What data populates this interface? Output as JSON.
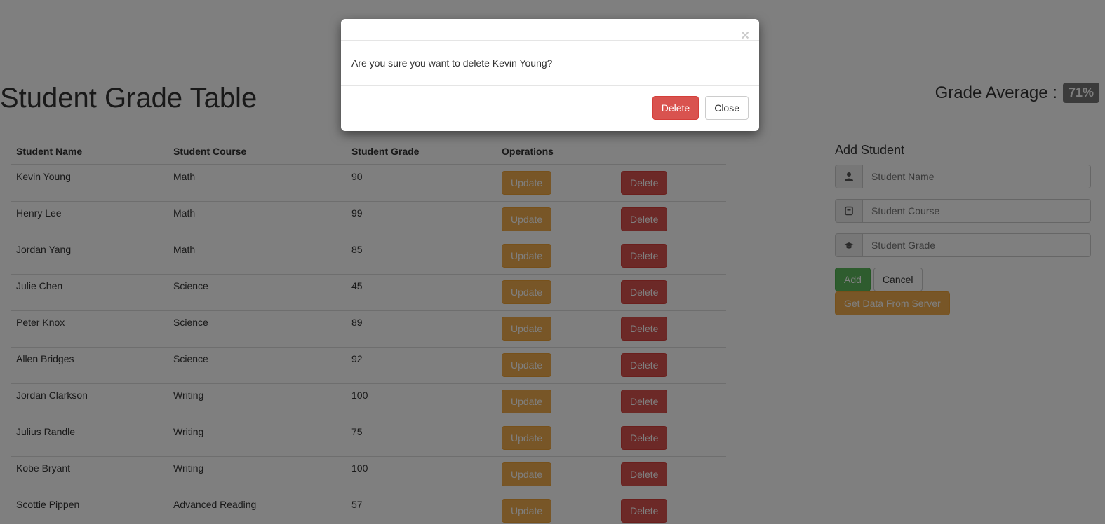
{
  "page": {
    "title": "Student Grade Table",
    "grade_average_label": "Grade Average :",
    "grade_average_value": "71%"
  },
  "table": {
    "headers": [
      "Student Name",
      "Student Course",
      "Student Grade",
      "Operations"
    ],
    "update_label": "Update",
    "delete_label": "Delete",
    "rows": [
      {
        "name": "Kevin Young",
        "course": "Math",
        "grade": "90"
      },
      {
        "name": "Henry Lee",
        "course": "Math",
        "grade": "99"
      },
      {
        "name": "Jordan Yang",
        "course": "Math",
        "grade": "85"
      },
      {
        "name": "Julie Chen",
        "course": "Science",
        "grade": "45"
      },
      {
        "name": "Peter Knox",
        "course": "Science",
        "grade": "89"
      },
      {
        "name": "Allen Bridges",
        "course": "Science",
        "grade": "92"
      },
      {
        "name": "Jordan Clarkson",
        "course": "Writing",
        "grade": "100"
      },
      {
        "name": "Julius Randle",
        "course": "Writing",
        "grade": "75"
      },
      {
        "name": "Kobe Bryant",
        "course": "Writing",
        "grade": "100"
      },
      {
        "name": "Scottie Pippen",
        "course": "Advanced Reading",
        "grade": "57"
      }
    ]
  },
  "add_student": {
    "title": "Add Student",
    "name_placeholder": "Student Name",
    "course_placeholder": "Student Course",
    "grade_placeholder": "Student Grade",
    "name_icon": "user-icon",
    "course_icon": "book-icon",
    "grade_icon": "graduation-cap-icon",
    "add_label": "Add",
    "cancel_label": "Cancel",
    "server_label": "Get Data From Server"
  },
  "modal": {
    "close_glyph": "×",
    "message": "Are you sure you want to delete Kevin Young?",
    "delete_label": "Delete",
    "close_label": "Close"
  },
  "colors": {
    "warning": "#f0ad4e",
    "danger": "#d9534f",
    "success": "#5cb85c",
    "badge": "#777777"
  }
}
